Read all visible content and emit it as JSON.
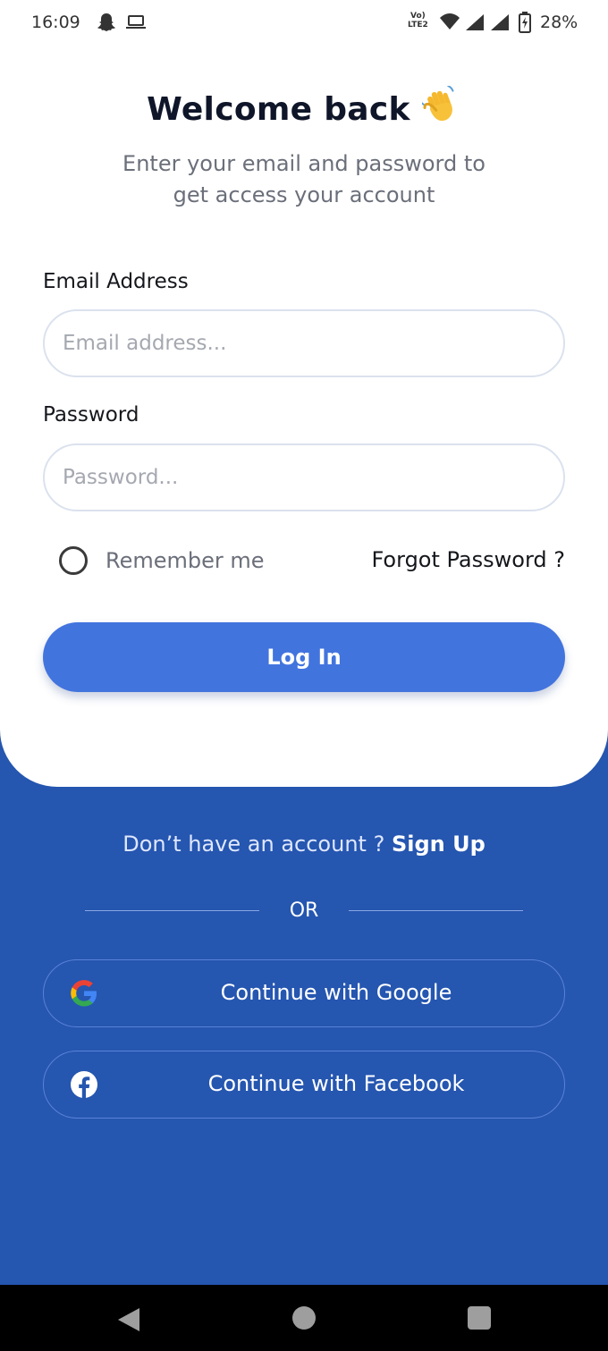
{
  "status_bar": {
    "time": "16:09",
    "network_line1": "Vo)",
    "network_line2": "LTE2",
    "battery": "28%",
    "icons": [
      "snapchat-ghost-icon",
      "laptop-icon",
      "wifi-icon",
      "signal-icon",
      "signal-icon",
      "battery-charging-icon"
    ]
  },
  "header": {
    "title": "Welcome back",
    "title_emoji": "waving-hand-icon",
    "subtitle_line1": "Enter your email and password to",
    "subtitle_line2": "get access your account"
  },
  "form": {
    "email_label": "Email Address",
    "email_placeholder": "Email address...",
    "password_label": "Password",
    "password_placeholder": "Password...",
    "remember_label": "Remember me",
    "remember_checked": false,
    "forgot_label": "Forgot Password ?",
    "login_label": "Log In"
  },
  "footer": {
    "signup_prompt": "Don’t have an account ?",
    "signup_link": "Sign Up",
    "or_label": "OR",
    "google_label": "Continue with Google",
    "facebook_label": "Continue with Facebook"
  },
  "colors": {
    "primary_blue": "#4274de",
    "background_blue": "#2556b0",
    "card_white": "#ffffff"
  }
}
